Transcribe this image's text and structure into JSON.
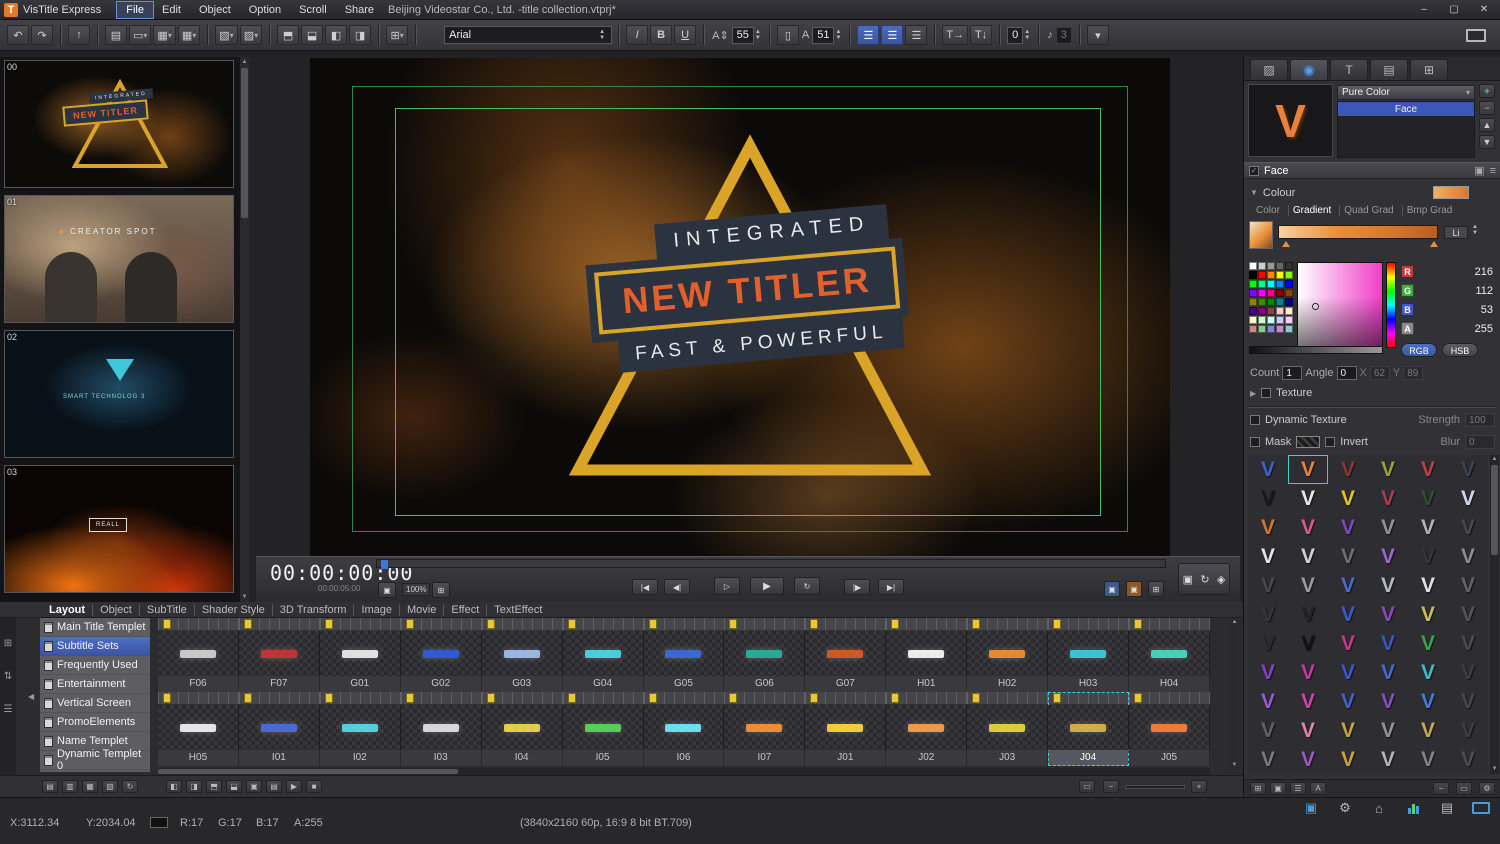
{
  "titlebar": {
    "logo": "T",
    "app_name": "VisTitle Express",
    "menus": [
      {
        "label": "File",
        "active": true
      },
      {
        "label": "Edit"
      },
      {
        "label": "Object"
      },
      {
        "label": "Option"
      },
      {
        "label": "Scroll"
      },
      {
        "label": "Share"
      }
    ],
    "document_title": "Beijing Videostar Co., Ltd. -title collection.vtprj*",
    "window_buttons": {
      "minimize": "–",
      "maximize": "▢",
      "close": "✕"
    }
  },
  "toolbar": {
    "undo": "↶",
    "redo": "↷",
    "italic": "I",
    "bold": "B",
    "underline": "U",
    "font_family": "Arial",
    "font_size": "55",
    "char_size": "51",
    "kerning": "0",
    "audio_level": "3"
  },
  "left_panel": {
    "thumbnails": [
      {
        "index": "00",
        "caption": "NEW TITLER",
        "top_caption": "INTEGRATED"
      },
      {
        "index": "01",
        "caption": "CREATOR SPOT"
      },
      {
        "index": "02",
        "caption": "SMART TECHNOLOG 3"
      },
      {
        "index": "03",
        "caption": "REALL"
      }
    ]
  },
  "preview": {
    "line_top": "INTEGRATED",
    "line_main": "NEW TITLER",
    "line_bottom": "FAST & POWERFUL"
  },
  "transport": {
    "timecode": "00:00:00:00",
    "duration": "00:00:05:00",
    "zoom": "100%",
    "buttons": {
      "to_start": "|◀",
      "frame_back": "◀|",
      "play_from": "▷",
      "play": "▶",
      "loop": "↻",
      "frame_fwd": "|▶",
      "to_end": "▶|",
      "export": "◈"
    }
  },
  "bottom_panel": {
    "tabs": [
      {
        "label": "Layout",
        "active": true
      },
      {
        "label": "Object"
      },
      {
        "label": "SubTitle"
      },
      {
        "label": "Shader Style"
      },
      {
        "label": "3D Transform"
      },
      {
        "label": "Image"
      },
      {
        "label": "Movie"
      },
      {
        "label": "Effect"
      },
      {
        "label": "TextEffect"
      }
    ],
    "categories": [
      {
        "label": "Main Title Templet"
      },
      {
        "label": "Subtitle Sets",
        "active": true
      },
      {
        "label": "Frequently Used"
      },
      {
        "label": "Entertainment"
      },
      {
        "label": "Vertical Screen"
      },
      {
        "label": "PromoElements"
      },
      {
        "label": "Name Templet"
      },
      {
        "label": "Dynamic Templet 0"
      }
    ],
    "grid_row1": [
      {
        "label": "F06",
        "accent": "#c8c8c8"
      },
      {
        "label": "F07",
        "accent": "#c03434"
      },
      {
        "label": "G01",
        "accent": "#e0e0e0"
      },
      {
        "label": "G02",
        "accent": "#2e5bd0"
      },
      {
        "label": "G03",
        "accent": "#9ab4e6"
      },
      {
        "label": "G04",
        "accent": "#49ccdd"
      },
      {
        "label": "G05",
        "accent": "#3a6ad0"
      },
      {
        "label": "G06",
        "accent": "#2aa898"
      },
      {
        "label": "G07",
        "accent": "#cc5a26"
      },
      {
        "label": "H01",
        "accent": "#ececec"
      },
      {
        "label": "H02",
        "accent": "#e08a36"
      },
      {
        "label": "H03",
        "accent": "#3ac2d4"
      },
      {
        "label": "H04",
        "accent": "#46d0bc"
      }
    ],
    "grid_row2": [
      {
        "label": "H05",
        "accent": "#e4e4e4"
      },
      {
        "label": "I01",
        "accent": "#4a6ad2"
      },
      {
        "label": "I02",
        "accent": "#56cede"
      },
      {
        "label": "I03",
        "accent": "#d6d6d6"
      },
      {
        "label": "I04",
        "accent": "#e2ce4a"
      },
      {
        "label": "I05",
        "accent": "#58cc58"
      },
      {
        "label": "I06",
        "accent": "#6adeee"
      },
      {
        "label": "I07",
        "accent": "#ee8c36"
      },
      {
        "label": "J01",
        "accent": "#eecc3a"
      },
      {
        "label": "J02",
        "accent": "#ee9a46"
      },
      {
        "label": "J03",
        "accent": "#decb39"
      },
      {
        "label": "J04",
        "accent": "#d2ac48",
        "sel": true
      },
      {
        "label": "J05",
        "accent": "#ee7a36"
      }
    ]
  },
  "right_panel": {
    "preview_letter": "V",
    "shader_type": "Pure Color",
    "layers": [
      {
        "label": "Face",
        "active": true
      }
    ],
    "face": {
      "title": "Face",
      "colour_label": "Colour",
      "tabs": [
        {
          "label": "Color"
        },
        {
          "label": "Gradient",
          "active": true
        },
        {
          "label": "Quad Grad"
        },
        {
          "label": "Bmp Grad"
        }
      ],
      "interp": "Li",
      "channels": [
        {
          "label": "R",
          "value": "216",
          "chip": "#c23c3c"
        },
        {
          "label": "G",
          "value": "112",
          "chip": "#3cae3c"
        },
        {
          "label": "B",
          "value": "53",
          "chip": "#3c5cc2"
        },
        {
          "label": "A",
          "value": "255",
          "chip": "#8a8a8a"
        }
      ],
      "mode_rgb": "RGB",
      "mode_hsb": "HSB",
      "count_label": "Count",
      "count": "1",
      "angle_label": "Angle",
      "angle": "0",
      "x_label": "X",
      "x": "62",
      "y_label": "Y",
      "y": "89",
      "texture_label": "Texture"
    },
    "dynamic_texture": {
      "label": "Dynamic Texture",
      "strength_label": "Strength",
      "strength": "100"
    },
    "mask": {
      "label": "Mask",
      "invert_label": "Invert",
      "blur_label": "Blur",
      "blur": "0"
    },
    "palette": [
      "#ffffff",
      "#cccccc",
      "#999999",
      "#666666",
      "#333333",
      "#000000",
      "#ff0000",
      "#ff8800",
      "#ffff00",
      "#88ff00",
      "#00ff00",
      "#00ff88",
      "#00ffff",
      "#0088ff",
      "#0000ff",
      "#8800ff",
      "#ff00ff",
      "#ff0088",
      "#880000",
      "#884400",
      "#888800",
      "#448800",
      "#008800",
      "#008888",
      "#000088",
      "#440088",
      "#880088",
      "#884444",
      "#ffcccc",
      "#ffeecc",
      "#ffffcc",
      "#ccffcc",
      "#ccffff",
      "#ccccff",
      "#ffccff",
      "#cc8888",
      "#88cc88",
      "#8888cc",
      "#cc88cc",
      "#88cccc"
    ],
    "styles": [
      {
        "c": "#3b62c8"
      },
      {
        "c": "#e8813a",
        "sel": true
      },
      {
        "c": "#8a3434"
      },
      {
        "c": "#97a032"
      },
      {
        "c": "#b84343"
      },
      {
        "c": "#3c4254"
      },
      {
        "c": "#1a1a1e"
      },
      {
        "c": "#ece4e6"
      },
      {
        "c": "#e5c224"
      },
      {
        "c": "#b03a52"
      },
      {
        "c": "#2f4f30"
      },
      {
        "c": "#ccd7ee"
      },
      {
        "c": "#cf7434"
      },
      {
        "c": "#d85a92"
      },
      {
        "c": "#7f48ba"
      },
      {
        "c": "#8f9199"
      },
      {
        "c": "#aeb1b7"
      },
      {
        "c": "#47494f"
      },
      {
        "c": "#e6e6ea"
      },
      {
        "c": "#cfd0d6"
      },
      {
        "c": "#6e7077"
      },
      {
        "c": "#9a68cc"
      },
      {
        "c": "#35373f"
      },
      {
        "c": "#8a8c93"
      },
      {
        "c": "#494a50"
      },
      {
        "c": "#9a9ba1"
      },
      {
        "c": "#4a6aca"
      },
      {
        "c": "#b1b9c1"
      },
      {
        "c": "#e0e1e7"
      },
      {
        "c": "#61636b"
      },
      {
        "c": "#36373d"
      },
      {
        "c": "#232329"
      },
      {
        "c": "#3b5bc1"
      },
      {
        "c": "#8948ba"
      },
      {
        "c": "#c9b961"
      },
      {
        "c": "#51535b"
      },
      {
        "c": "#2b2b31"
      },
      {
        "c": "#121216"
      },
      {
        "c": "#c13a92"
      },
      {
        "c": "#395ac1"
      },
      {
        "c": "#3aa24a"
      },
      {
        "c": "#494b53"
      },
      {
        "c": "#8142c2"
      },
      {
        "c": "#c23aa2"
      },
      {
        "c": "#395ac9"
      },
      {
        "c": "#4969d1"
      },
      {
        "c": "#41bac9"
      },
      {
        "c": "#3b3d45"
      },
      {
        "c": "#9959d9"
      },
      {
        "c": "#d142a9"
      },
      {
        "c": "#4161cd"
      },
      {
        "c": "#8151c1"
      },
      {
        "c": "#4979d9"
      },
      {
        "c": "#45474f"
      },
      {
        "c": "#616169"
      },
      {
        "c": "#e182b1"
      },
      {
        "c": "#c9a142"
      },
      {
        "c": "#919299"
      },
      {
        "c": "#c9a959"
      },
      {
        "c": "#3d3f47"
      },
      {
        "c": "#78797f"
      },
      {
        "c": "#9b59c1"
      },
      {
        "c": "#cba33e"
      },
      {
        "c": "#b1b1b7"
      },
      {
        "c": "#818189"
      },
      {
        "c": "#4b4d55"
      }
    ]
  },
  "status_bar": {
    "x": "X:3112.34",
    "y": "Y:2034.04",
    "r": "R:17",
    "g": "G:17",
    "b": "B:17",
    "a": "A:255",
    "format": "(3840x2160 60p, 16:9 8 bit BT.709)"
  }
}
